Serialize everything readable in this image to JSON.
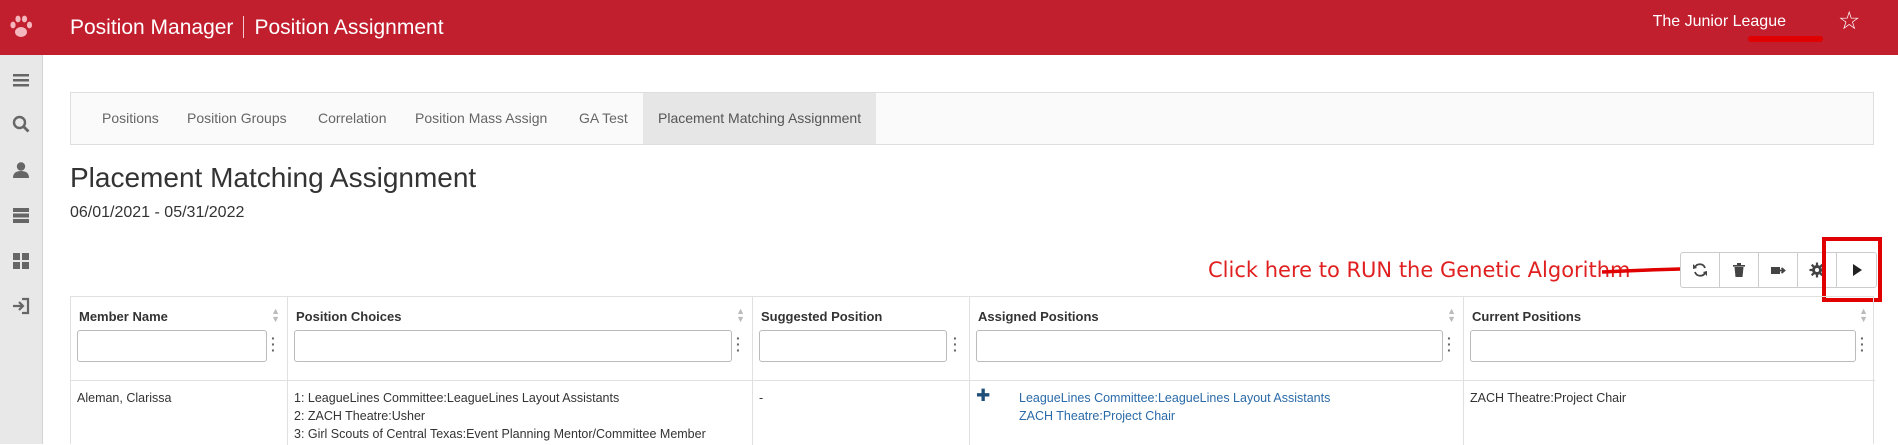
{
  "header": {
    "app_name": "Position Manager",
    "page_name": "Position Assignment",
    "org_name": "The Junior League"
  },
  "tabs": [
    {
      "label": "Positions"
    },
    {
      "label": "Position Groups"
    },
    {
      "label": "Correlation"
    },
    {
      "label": "Position Mass Assign"
    },
    {
      "label": "GA Test"
    },
    {
      "label": "Placement Matching Assignment",
      "active": true
    }
  ],
  "page": {
    "title": "Placement Matching Assignment",
    "date_range": "06/01/2021 - 05/31/2022"
  },
  "annotation": {
    "text": "Click here to RUN the Genetic Algorithm",
    "color": "#e02020"
  },
  "grid": {
    "columns": [
      {
        "label": "Member Name"
      },
      {
        "label": "Position Choices"
      },
      {
        "label": "Suggested Position"
      },
      {
        "label": "Assigned Positions"
      },
      {
        "label": "Current Positions"
      }
    ],
    "row": {
      "member_name": "Aleman, Clarissa",
      "choices": [
        "1: LeagueLines Committee:LeagueLines Layout Assistants",
        "2: ZACH Theatre:Usher",
        "3: Girl Scouts of Central Texas:Event Planning Mentor/Committee Member"
      ],
      "suggested": "-",
      "assigned": [
        "LeagueLines Committee:LeagueLines Layout Assistants",
        "ZACH Theatre:Project Chair"
      ],
      "current": "ZACH Theatre:Project Chair"
    }
  },
  "colors": {
    "brand": "#c11e2e",
    "link": "#2a6aa8",
    "highlight": "#e00000"
  }
}
